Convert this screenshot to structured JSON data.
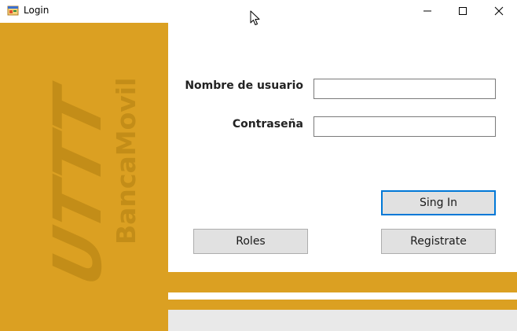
{
  "window": {
    "title": "Login"
  },
  "colors": {
    "accent": "#dba022",
    "accent_dark": "#c38d18",
    "focus_border": "#0078d7"
  },
  "brand": {
    "logo_text": "UTTT",
    "app_name": "BancaMovil"
  },
  "form": {
    "username_label": "Nombre de usuario",
    "username_value": "",
    "password_label": "Contraseña",
    "password_value": ""
  },
  "buttons": {
    "sign_in": "Sing In",
    "roles": "Roles",
    "register": "Registrate"
  },
  "icons": {
    "app": "form-window-icon",
    "minimize": "minimize-icon",
    "maximize": "maximize-icon",
    "close": "close-icon",
    "cursor": "mouse-pointer-icon"
  }
}
